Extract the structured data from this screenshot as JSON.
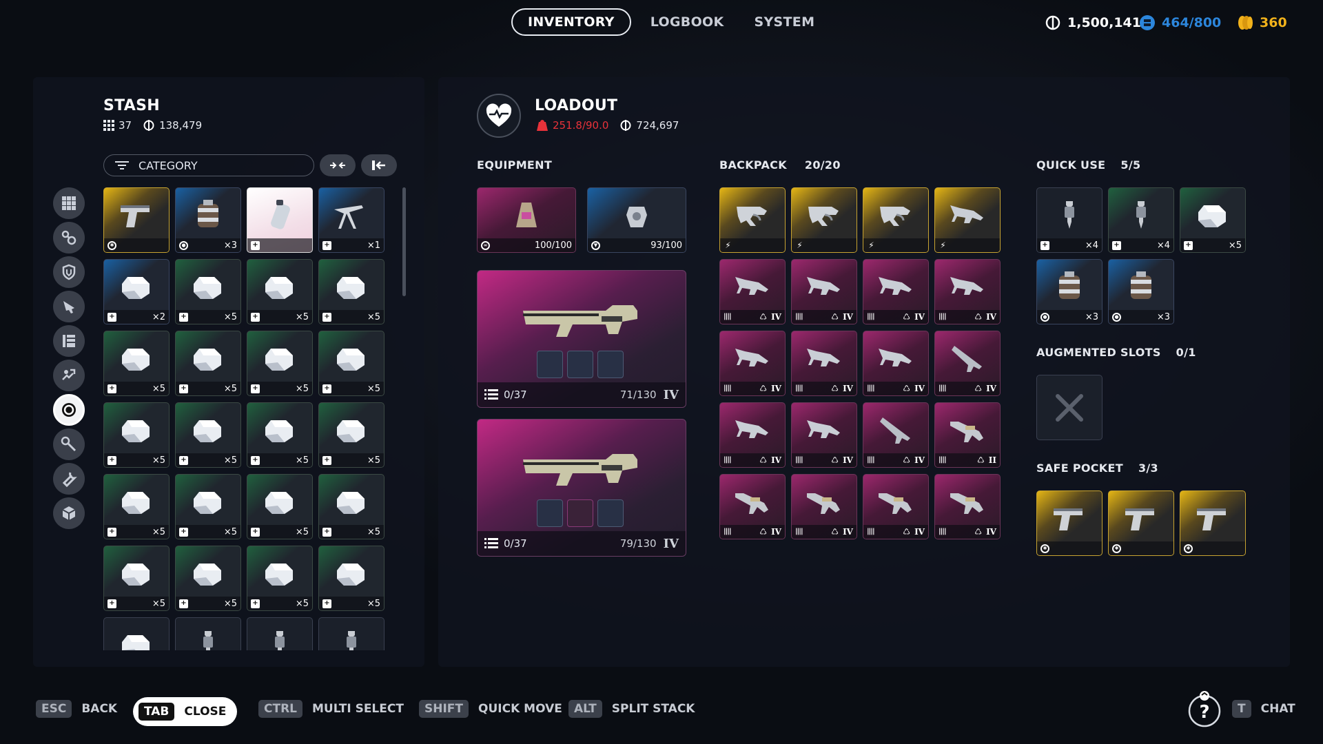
{
  "top_tabs": [
    "INVENTORY",
    "LOGBOOK",
    "SYSTEM"
  ],
  "currencies": {
    "coins": "1,500,141",
    "capacity": "464/800",
    "tokens": "360"
  },
  "stash": {
    "title": "STASH",
    "count": "37",
    "value": "138,479",
    "category_label": "CATEGORY",
    "side_icons": [
      "grid-icon",
      "materials-icon",
      "shield-icon",
      "weapon-icon",
      "book-icon",
      "mods-icon",
      "target-icon",
      "wrench-key-icon",
      "wrench-icon",
      "box-icon"
    ],
    "items": [
      {
        "rarity": "y",
        "icon": "pistol",
        "badge": "c",
        "qty": ""
      },
      {
        "rarity": "b",
        "icon": "grenade",
        "badge": "o",
        "qty": "×3"
      },
      {
        "rarity": "w",
        "icon": "canister",
        "badge": "+",
        "qty": ""
      },
      {
        "rarity": "b",
        "icon": "turret",
        "badge": "+",
        "qty": "×1"
      },
      {
        "rarity": "b",
        "icon": "bandage",
        "badge": "+",
        "qty": "×2"
      },
      {
        "rarity": "g",
        "icon": "bandage",
        "badge": "+",
        "qty": "×5"
      },
      {
        "rarity": "g",
        "icon": "bandage",
        "badge": "+",
        "qty": "×5"
      },
      {
        "rarity": "g",
        "icon": "bandage",
        "badge": "+",
        "qty": "×5"
      },
      {
        "rarity": "g",
        "icon": "bandage",
        "badge": "+",
        "qty": "×5"
      },
      {
        "rarity": "g",
        "icon": "bandage",
        "badge": "+",
        "qty": "×5"
      },
      {
        "rarity": "g",
        "icon": "bandage",
        "badge": "+",
        "qty": "×5"
      },
      {
        "rarity": "g",
        "icon": "bandage",
        "badge": "+",
        "qty": "×5"
      },
      {
        "rarity": "g",
        "icon": "bandage",
        "badge": "+",
        "qty": "×5"
      },
      {
        "rarity": "g",
        "icon": "bandage",
        "badge": "+",
        "qty": "×5"
      },
      {
        "rarity": "g",
        "icon": "bandage",
        "badge": "+",
        "qty": "×5"
      },
      {
        "rarity": "g",
        "icon": "bandage",
        "badge": "+",
        "qty": "×5"
      },
      {
        "rarity": "g",
        "icon": "bandage",
        "badge": "+",
        "qty": "×5"
      },
      {
        "rarity": "g",
        "icon": "bandage",
        "badge": "+",
        "qty": "×5"
      },
      {
        "rarity": "g",
        "icon": "bandage",
        "badge": "+",
        "qty": "×5"
      },
      {
        "rarity": "g",
        "icon": "bandage",
        "badge": "+",
        "qty": "×5"
      },
      {
        "rarity": "g",
        "icon": "bandage",
        "badge": "+",
        "qty": "×5"
      },
      {
        "rarity": "g",
        "icon": "bandage",
        "badge": "+",
        "qty": "×5"
      },
      {
        "rarity": "g",
        "icon": "bandage",
        "badge": "+",
        "qty": "×5"
      },
      {
        "rarity": "g",
        "icon": "bandage",
        "badge": "+",
        "qty": "×5"
      },
      {
        "rarity": "e",
        "icon": "bandage",
        "badge": "",
        "qty": ""
      },
      {
        "rarity": "e",
        "icon": "syringe",
        "badge": "",
        "qty": ""
      },
      {
        "rarity": "e",
        "icon": "syringe",
        "badge": "",
        "qty": ""
      },
      {
        "rarity": "e",
        "icon": "syringe",
        "badge": "",
        "qty": ""
      }
    ]
  },
  "loadout": {
    "title": "LOADOUT",
    "weight": "251.8/90.0",
    "value": "724,697",
    "equipment_label": "EQUIPMENT",
    "equipment": [
      {
        "rarity": "p",
        "icon": "backpack",
        "badge": "mat",
        "qty": "100/100"
      },
      {
        "rarity": "b",
        "icon": "augment",
        "badge": "shield",
        "qty": "93/100"
      }
    ],
    "weapons": [
      {
        "ammo": "0/37",
        "durability": "71/130",
        "tier": "IV"
      },
      {
        "ammo": "0/37",
        "durability": "79/130",
        "tier": "IV"
      }
    ],
    "backpack_label": "BACKPACK",
    "backpack_count": "20/20",
    "backpack": [
      {
        "rarity": "y",
        "icon": "smg",
        "badge": "bolt",
        "tier": ""
      },
      {
        "rarity": "y",
        "icon": "smg",
        "badge": "bolt",
        "tier": ""
      },
      {
        "rarity": "y",
        "icon": "smg",
        "badge": "bolt",
        "tier": ""
      },
      {
        "rarity": "y",
        "icon": "rifle",
        "badge": "bolt",
        "tier": ""
      },
      {
        "rarity": "p",
        "icon": "rifle",
        "badge": "bar",
        "tier": "IV"
      },
      {
        "rarity": "p",
        "icon": "rifle",
        "badge": "bar",
        "tier": "IV"
      },
      {
        "rarity": "p",
        "icon": "rifle",
        "badge": "bar",
        "tier": "IV"
      },
      {
        "rarity": "p",
        "icon": "rifle",
        "badge": "bar",
        "tier": "IV"
      },
      {
        "rarity": "p",
        "icon": "rifle",
        "badge": "bar",
        "tier": "IV"
      },
      {
        "rarity": "p",
        "icon": "rifle",
        "badge": "bar",
        "tier": "IV"
      },
      {
        "rarity": "p",
        "icon": "rifle",
        "badge": "bar",
        "tier": "IV"
      },
      {
        "rarity": "p",
        "icon": "sniper",
        "badge": "bar",
        "tier": "IV"
      },
      {
        "rarity": "p",
        "icon": "rifle",
        "badge": "bar",
        "tier": "IV"
      },
      {
        "rarity": "p",
        "icon": "rifle",
        "badge": "bar",
        "tier": "IV"
      },
      {
        "rarity": "p",
        "icon": "sniper",
        "badge": "bar",
        "tier": "IV"
      },
      {
        "rarity": "p",
        "icon": "shotgun",
        "badge": "bar",
        "tier": "II"
      },
      {
        "rarity": "p",
        "icon": "shotgun",
        "badge": "bar",
        "tier": "IV"
      },
      {
        "rarity": "p",
        "icon": "shotgun",
        "badge": "bar",
        "tier": "IV"
      },
      {
        "rarity": "p",
        "icon": "shotgun",
        "badge": "bar",
        "tier": "IV"
      },
      {
        "rarity": "p",
        "icon": "shotgun",
        "badge": "bar",
        "tier": "IV"
      }
    ],
    "quick_use_label": "QUICK USE",
    "quick_use_count": "5/5",
    "quick_use": [
      {
        "rarity": "e",
        "icon": "syringe",
        "badge": "+",
        "qty": "×4"
      },
      {
        "rarity": "g",
        "icon": "syringe",
        "badge": "+",
        "qty": "×4"
      },
      {
        "rarity": "g",
        "icon": "bandage",
        "badge": "+",
        "qty": "×5"
      },
      {
        "rarity": "b",
        "icon": "grenade",
        "badge": "o",
        "qty": "×3"
      },
      {
        "rarity": "b",
        "icon": "grenade",
        "badge": "o",
        "qty": "×3"
      }
    ],
    "augmented_label": "AUGMENTED SLOTS",
    "augmented_count": "0/1",
    "safe_pocket_label": "SAFE POCKET",
    "safe_pocket_count": "3/3",
    "safe_pocket": [
      {
        "rarity": "y",
        "icon": "pistol",
        "badge": "c",
        "qty": ""
      },
      {
        "rarity": "y",
        "icon": "pistol",
        "badge": "c",
        "qty": ""
      },
      {
        "rarity": "y",
        "icon": "pistol",
        "badge": "c",
        "qty": ""
      }
    ]
  },
  "hints": {
    "esc_key": "ESC",
    "esc_label": "BACK",
    "tab_key": "TAB",
    "tab_label": "CLOSE",
    "ctrl_key": "CTRL",
    "ctrl_label": "MULTI SELECT",
    "shift_key": "SHIFT",
    "shift_label": "QUICK MOVE",
    "alt_key": "ALT",
    "alt_label": "SPLIT STACK",
    "t_key": "T",
    "t_label": "CHAT"
  },
  "colors": {
    "accent": "#e4308f",
    "gold": "#f2b21b",
    "blue": "#2c86dc",
    "green": "#2ea05a",
    "danger": "#e8323a"
  }
}
